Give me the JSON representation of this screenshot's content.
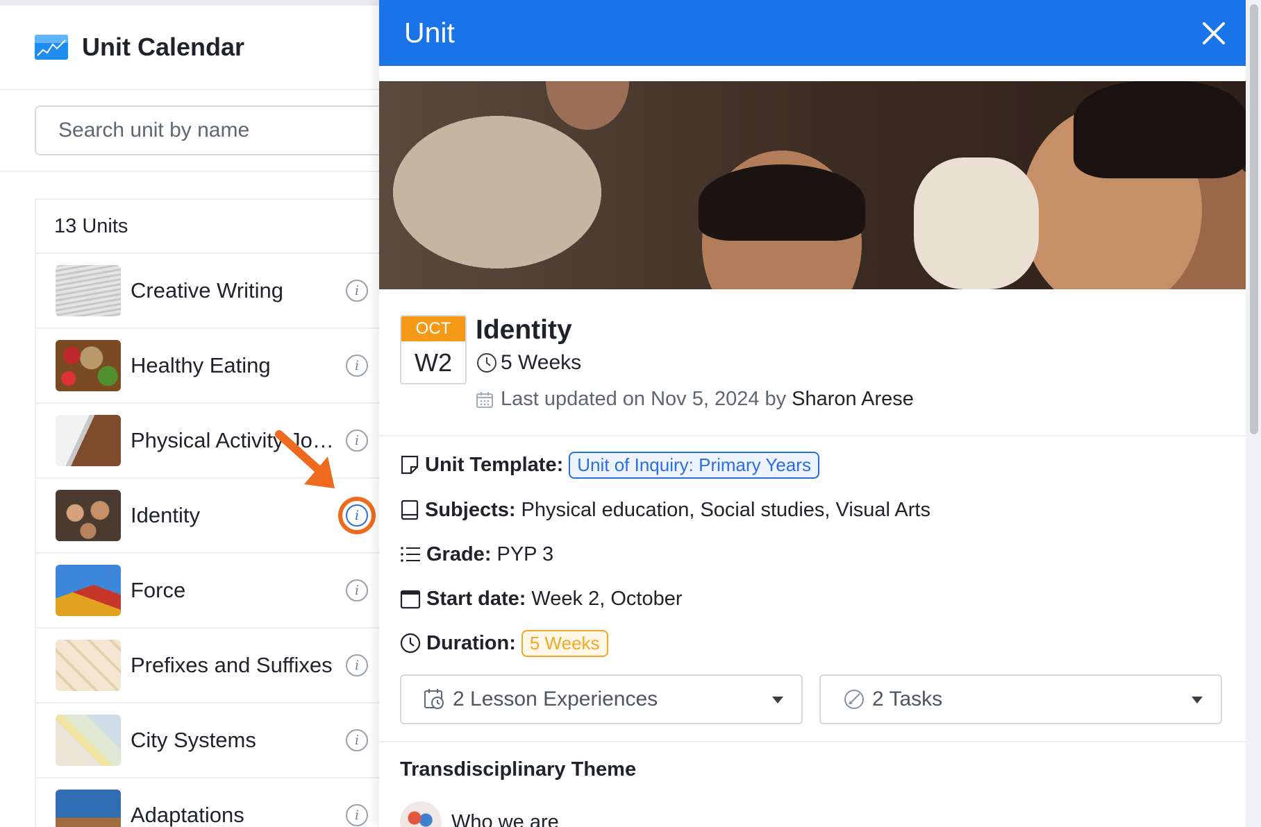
{
  "sidebar": {
    "title": "Unit Calendar",
    "search_placeholder": "Search unit by name",
    "count_label": "13 Units",
    "units": [
      {
        "name": "Creative Writing"
      },
      {
        "name": "Healthy Eating"
      },
      {
        "name": "Physical Activity Journal"
      },
      {
        "name": "Identity"
      },
      {
        "name": "Force"
      },
      {
        "name": "Prefixes and Suffixes"
      },
      {
        "name": "City Systems"
      },
      {
        "name": "Adaptations"
      }
    ]
  },
  "panel": {
    "header_title": "Unit",
    "date": {
      "month": "OCT",
      "week": "W2"
    },
    "unit_title": "Identity",
    "weeks": "5 Weeks",
    "updated_prefix": "Last updated on Nov 5, 2024 by",
    "updated_by": "Sharon Arese",
    "template_label": "Unit Template:",
    "template_value": "Unit of Inquiry: Primary Years",
    "subjects_label": "Subjects:",
    "subjects_value": "Physical education, Social studies, Visual Arts",
    "grade_label": "Grade:",
    "grade_value": "PYP 3",
    "start_label": "Start date:",
    "start_value": "Week 2, October",
    "duration_label": "Duration:",
    "duration_value": "5 Weeks",
    "lessons_dropdown": "2 Lesson Experiences",
    "tasks_dropdown": "2 Tasks",
    "theme_section": "Transdisciplinary Theme",
    "theme_value": "Who we are"
  },
  "colors": {
    "header_blue": "#1b73e8",
    "badge_orange": "#f59a16",
    "chip_blue": "#2a6de0",
    "chip_orange": "#f5a623",
    "highlight_orange": "#ee6a1d"
  }
}
